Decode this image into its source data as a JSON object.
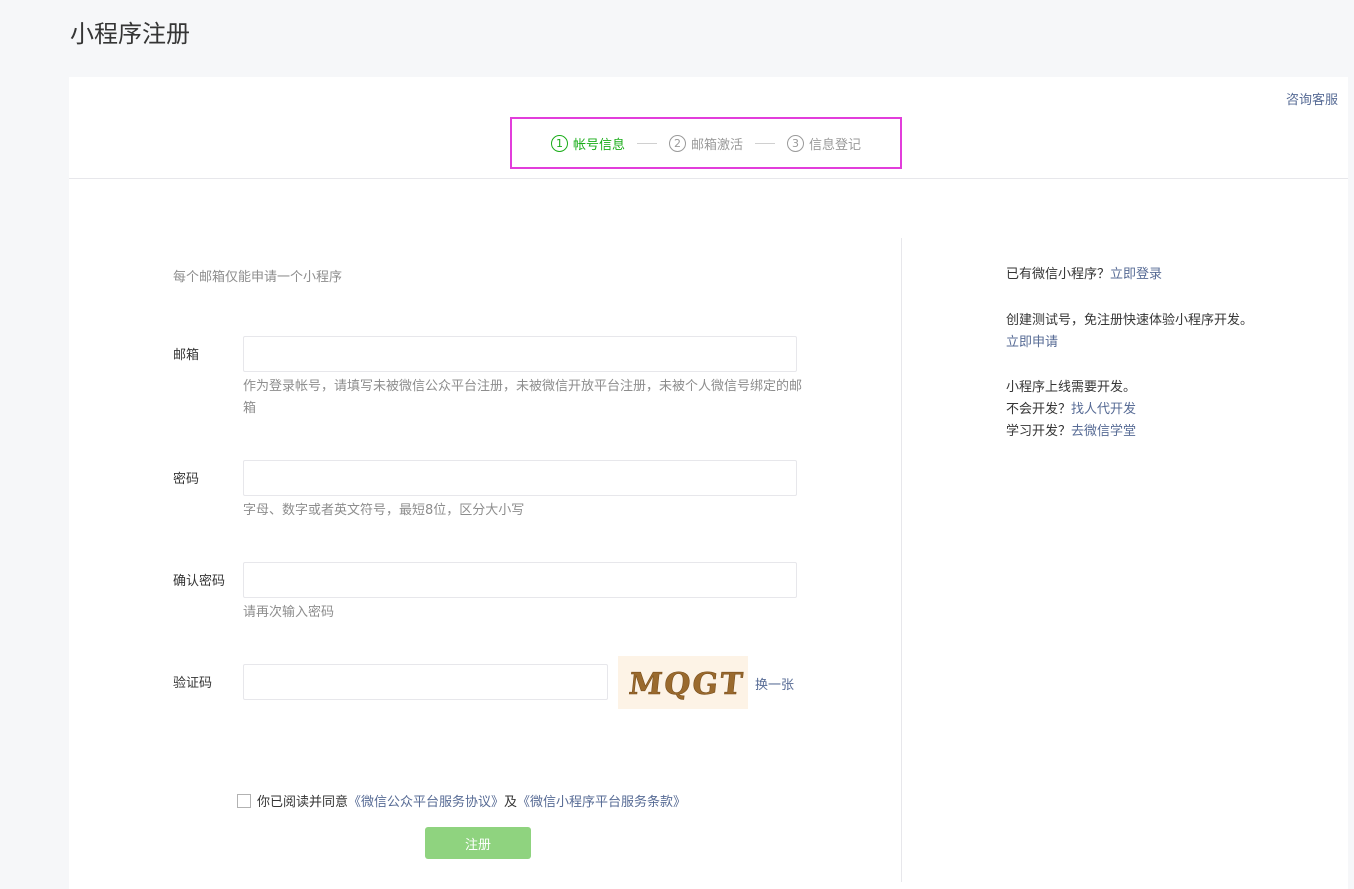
{
  "page": {
    "title": "小程序注册"
  },
  "header": {
    "consult_link": "咨询客服"
  },
  "steps": [
    {
      "num": "1",
      "label": "帐号信息",
      "active": true
    },
    {
      "num": "2",
      "label": "邮箱激活",
      "active": false
    },
    {
      "num": "3",
      "label": "信息登记",
      "active": false
    }
  ],
  "form": {
    "notice": "每个邮箱仅能申请一个小程序",
    "email": {
      "label": "邮箱",
      "value": "",
      "hint": "作为登录帐号，请填写未被微信公众平台注册，未被微信开放平台注册，未被个人微信号绑定的邮箱"
    },
    "password": {
      "label": "密码",
      "value": "",
      "hint": "字母、数字或者英文符号，最短8位，区分大小写"
    },
    "confirm": {
      "label": "确认密码",
      "value": "",
      "hint": "请再次输入密码"
    },
    "captcha": {
      "label": "验证码",
      "value": "",
      "image_text": "MQGT",
      "refresh_label": "换一张"
    },
    "agreement": {
      "prefix": "你已阅读并同意",
      "link1": "《微信公众平台服务协议》",
      "conj": "及",
      "link2": "《微信小程序平台服务条款》",
      "checked": false
    },
    "submit_label": "注册"
  },
  "sidebar": {
    "login_prefix": "已有微信小程序？",
    "login_link": "立即登录",
    "test_text": "创建测试号，免注册快速体验小程序开发。",
    "test_link": "立即申请",
    "dev_line": "小程序上线需要开发。",
    "hire_prefix": "不会开发？",
    "hire_link": "找人代开发",
    "learn_prefix": "学习开发？",
    "learn_link": "去微信学堂"
  },
  "colors": {
    "accent_green": "#1aad19",
    "link_blue": "#576b95",
    "highlight_magenta": "#e23ddb",
    "button_disabled_green": "#8fd37f"
  }
}
